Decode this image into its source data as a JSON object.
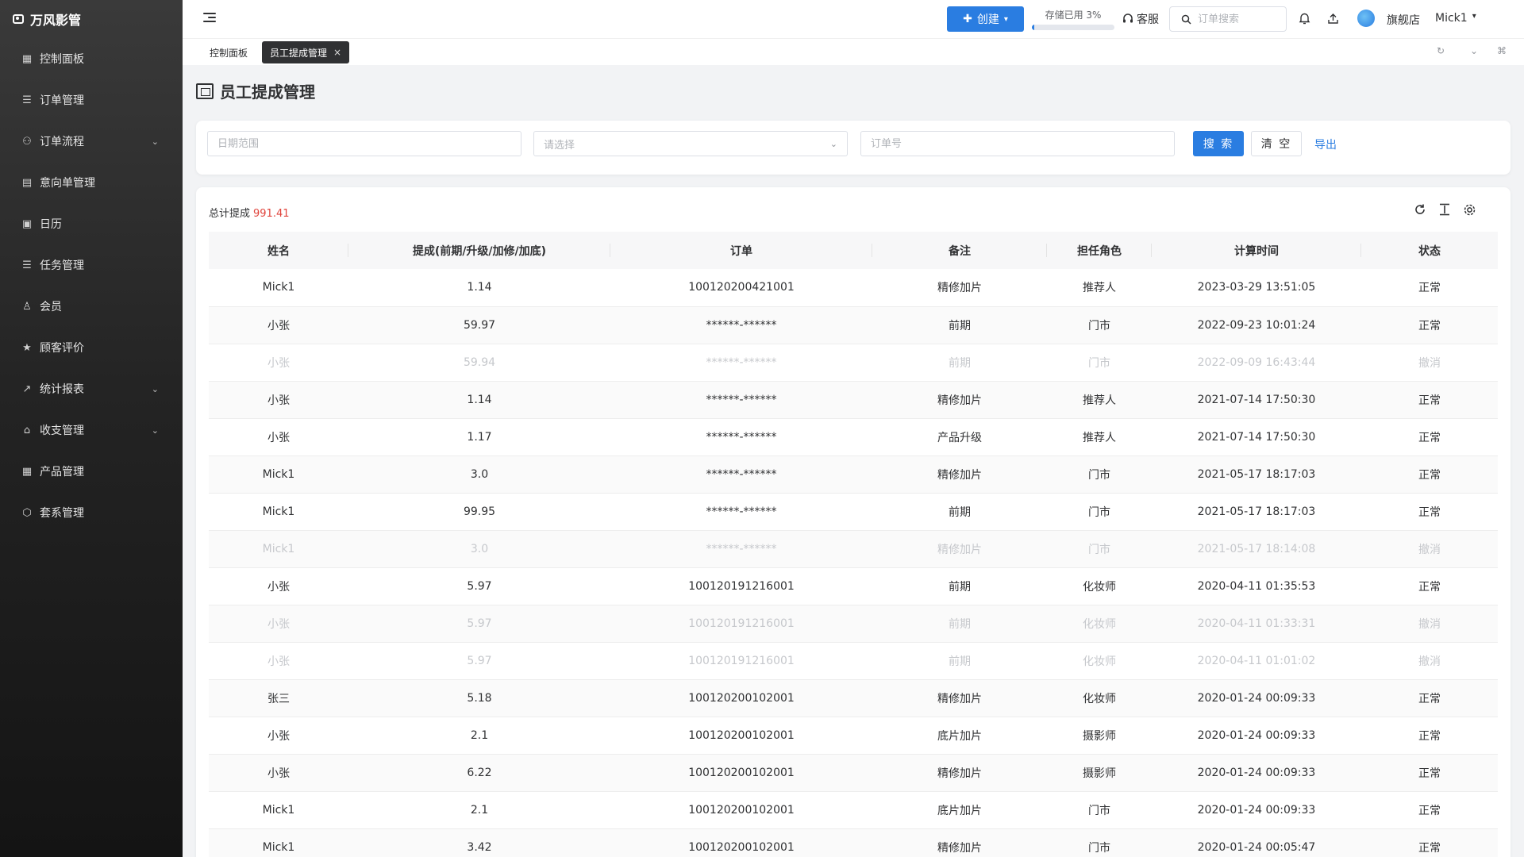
{
  "app": {
    "brand": "万风影管"
  },
  "sidebar": {
    "items": [
      {
        "label": "控制面板",
        "icon": "▦",
        "chevron": false
      },
      {
        "label": "订单管理",
        "icon": "☰",
        "chevron": false
      },
      {
        "label": "订单流程",
        "icon": "⚇",
        "chevron": true
      },
      {
        "label": "意向单管理",
        "icon": "▤",
        "chevron": false
      },
      {
        "label": "日历",
        "icon": "▣",
        "chevron": false
      },
      {
        "label": "任务管理",
        "icon": "☰",
        "chevron": false
      },
      {
        "label": "会员",
        "icon": "♙",
        "chevron": false
      },
      {
        "label": "顾客评价",
        "icon": "★",
        "chevron": false
      },
      {
        "label": "统计报表",
        "icon": "↗",
        "chevron": true
      },
      {
        "label": "收支管理",
        "icon": "⌂",
        "chevron": true
      },
      {
        "label": "产品管理",
        "icon": "▦",
        "chevron": false
      },
      {
        "label": "套系管理",
        "icon": "⬡",
        "chevron": false
      }
    ]
  },
  "header": {
    "create_label": "创建",
    "storage_label": "存储已用 3%",
    "storage_percent": 3,
    "service_label": "客服",
    "search_placeholder": "订单搜索",
    "store_name": "旗舰店",
    "user_name": "Mick1"
  },
  "tabs": {
    "dashboard": "控制面板",
    "active": "员工提成管理",
    "close": "×"
  },
  "page": {
    "title": "员工提成管理"
  },
  "filters": {
    "date_placeholder": "日期范围",
    "select_placeholder": "请选择",
    "order_placeholder": "订单号",
    "search_label": "搜 索",
    "clear_label": "清 空",
    "export_label": "导出"
  },
  "summary": {
    "label": "总计提成",
    "value": "991.41"
  },
  "table": {
    "columns": [
      "姓名",
      "提成(前期/升级/加修/加底)",
      "订单",
      "备注",
      "担任角色",
      "计算时间",
      "状态"
    ],
    "rows": [
      {
        "name": "Mick1",
        "amount": "1.14",
        "order": "100120200421001",
        "note": "精修加片",
        "role": "推荐人",
        "time": "2023-03-29 13:51:05",
        "status": "正常",
        "cancelled": false
      },
      {
        "name": "小张",
        "amount": "59.97",
        "order": "******-******",
        "note": "前期",
        "role": "门市",
        "time": "2022-09-23 10:01:24",
        "status": "正常",
        "cancelled": false
      },
      {
        "name": "小张",
        "amount": "59.94",
        "order": "******-******",
        "note": "前期",
        "role": "门市",
        "time": "2022-09-09 16:43:44",
        "status": "撤消",
        "cancelled": true
      },
      {
        "name": "小张",
        "amount": "1.14",
        "order": "******-******",
        "note": "精修加片",
        "role": "推荐人",
        "time": "2021-07-14 17:50:30",
        "status": "正常",
        "cancelled": false
      },
      {
        "name": "小张",
        "amount": "1.17",
        "order": "******-******",
        "note": "产品升级",
        "role": "推荐人",
        "time": "2021-07-14 17:50:30",
        "status": "正常",
        "cancelled": false
      },
      {
        "name": "Mick1",
        "amount": "3.0",
        "order": "******-******",
        "note": "精修加片",
        "role": "门市",
        "time": "2021-05-17 18:17:03",
        "status": "正常",
        "cancelled": false
      },
      {
        "name": "Mick1",
        "amount": "99.95",
        "order": "******-******",
        "note": "前期",
        "role": "门市",
        "time": "2021-05-17 18:17:03",
        "status": "正常",
        "cancelled": false
      },
      {
        "name": "Mick1",
        "amount": "3.0",
        "order": "******-******",
        "note": "精修加片",
        "role": "门市",
        "time": "2021-05-17 18:14:08",
        "status": "撤消",
        "cancelled": true
      },
      {
        "name": "小张",
        "amount": "5.97",
        "order": "100120191216001",
        "note": "前期",
        "role": "化妆师",
        "time": "2020-04-11 01:35:53",
        "status": "正常",
        "cancelled": false
      },
      {
        "name": "小张",
        "amount": "5.97",
        "order": "100120191216001",
        "note": "前期",
        "role": "化妆师",
        "time": "2020-04-11 01:33:31",
        "status": "撤消",
        "cancelled": true
      },
      {
        "name": "小张",
        "amount": "5.97",
        "order": "100120191216001",
        "note": "前期",
        "role": "化妆师",
        "time": "2020-04-11 01:01:02",
        "status": "撤消",
        "cancelled": true
      },
      {
        "name": "张三",
        "amount": "5.18",
        "order": "100120200102001",
        "note": "精修加片",
        "role": "化妆师",
        "time": "2020-01-24 00:09:33",
        "status": "正常",
        "cancelled": false
      },
      {
        "name": "小张",
        "amount": "2.1",
        "order": "100120200102001",
        "note": "底片加片",
        "role": "摄影师",
        "time": "2020-01-24 00:09:33",
        "status": "正常",
        "cancelled": false
      },
      {
        "name": "小张",
        "amount": "6.22",
        "order": "100120200102001",
        "note": "精修加片",
        "role": "摄影师",
        "time": "2020-01-24 00:09:33",
        "status": "正常",
        "cancelled": false
      },
      {
        "name": "Mick1",
        "amount": "2.1",
        "order": "100120200102001",
        "note": "底片加片",
        "role": "门市",
        "time": "2020-01-24 00:09:33",
        "status": "正常",
        "cancelled": false
      },
      {
        "name": "Mick1",
        "amount": "3.42",
        "order": "100120200102001",
        "note": "精修加片",
        "role": "门市",
        "time": "2020-01-24 00:05:47",
        "status": "正常",
        "cancelled": false
      }
    ]
  },
  "colors": {
    "primary": "#2a7de1",
    "total": "#e0443c",
    "cancelled_text": "#c6c8cc"
  }
}
